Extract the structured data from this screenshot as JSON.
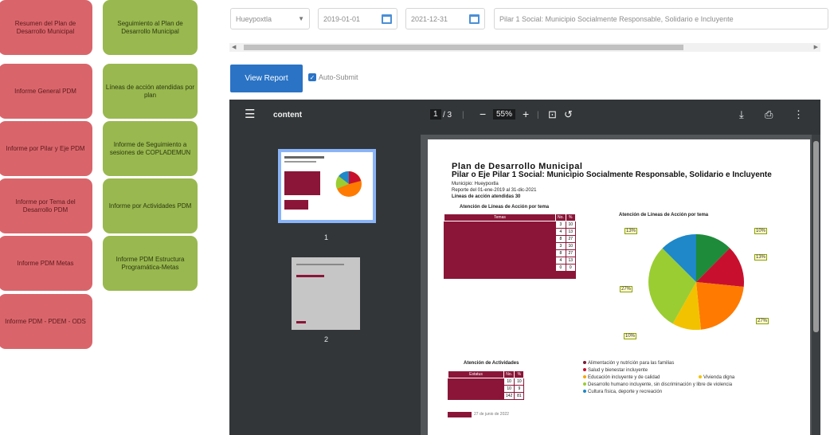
{
  "tiles": {
    "red": [
      {
        "label": "Resumen del Plan de Desarrollo Municipal"
      },
      {
        "label": "Informe General PDM"
      },
      {
        "label": "Informe por Pilar y Eje PDM"
      },
      {
        "label": "Informe por Tema del Desarrollo PDM"
      },
      {
        "label": "Informe PDM Metas"
      },
      {
        "label": "Informe PDM - PDEM - ODS"
      }
    ],
    "green": [
      {
        "label": "Seguimiento al Plan de Desarrollo Municipal"
      },
      {
        "label": "Líneas de acción atendidas por plan"
      },
      {
        "label": "Informe de Seguimiento a sesiones de COPLADEMUN"
      },
      {
        "label": "Informe por Actividades PDM"
      },
      {
        "label": "Informe PDM Estructura Programática-Metas"
      }
    ]
  },
  "filters": {
    "municipio": "Hueypoxtla",
    "start_date": "2019-01-01",
    "end_date": "2021-12-31",
    "pilar": "Pilar 1 Social: Municipio Socialmente Responsable, Solidario e Incluyente"
  },
  "view_report_label": "View Report",
  "auto_submit_label": "Auto-Submit",
  "viewer": {
    "filename": "content",
    "page_current": "1",
    "page_total": "/ 3",
    "zoom": "55%",
    "thumb_labels": [
      "1",
      "2"
    ]
  },
  "pdf_page": {
    "title1": "Plan de Desarrollo Municipal",
    "title2": "Pilar o Eje  Pilar 1 Social: Municipio Socialmente Responsable, Solidario e Incluyente",
    "line1": "Municipio:  Hueypoxtla",
    "line2": "Reporte del 01-ene-2019  al 31-dic-2021",
    "line3": "Líneas de acción atendidas   30",
    "table_title": "Atención de Líneas de Acción por tema",
    "table_headers": [
      "Temas",
      "No.",
      "%"
    ],
    "table_rows": [
      {
        "n": "3",
        "p": "10"
      },
      {
        "n": "4",
        "p": "13"
      },
      {
        "n": "8",
        "p": "27"
      },
      {
        "n": "3",
        "p": "10"
      },
      {
        "n": "8",
        "p": "27"
      },
      {
        "n": "4",
        "p": "13"
      },
      {
        "n": "0",
        "p": "0"
      }
    ],
    "chart_title": "Atención de Líneas de Acción por tema",
    "callouts": [
      "13%",
      "10%",
      "13%",
      "27%",
      "27%",
      "10%"
    ],
    "activities_title": "Atención de Actividades",
    "activities_headers": [
      "Estatus",
      "No.",
      "%"
    ],
    "activities_rows": [
      {
        "n": "10",
        "p": "10"
      },
      {
        "n": "10",
        "p": "9"
      },
      {
        "n": "142",
        "p": "81"
      }
    ],
    "footer_date": "27 de junio de 2022",
    "legend": [
      {
        "label": "Alimentación y nutrición para las familias",
        "color": "#7a1a36"
      },
      {
        "label": "Salud y bienestar incluyente",
        "color": "#c8102e"
      },
      {
        "label": "Educación incluyente y de calidad",
        "color": "#f7a600"
      },
      {
        "label": "Vivienda digna",
        "color": "#f2c200"
      },
      {
        "label": "Desarrollo humano incluyente, sin discriminación y libre de violencia",
        "color": "#9acd32"
      },
      {
        "label": "Cultura física, deporte y recreación",
        "color": "#1e88c8"
      }
    ]
  },
  "colors": {
    "red_tile": "#d9656b",
    "green_tile": "#99b84f",
    "accent": "#2a73c5",
    "pdf_maroon": "#8b1538"
  }
}
